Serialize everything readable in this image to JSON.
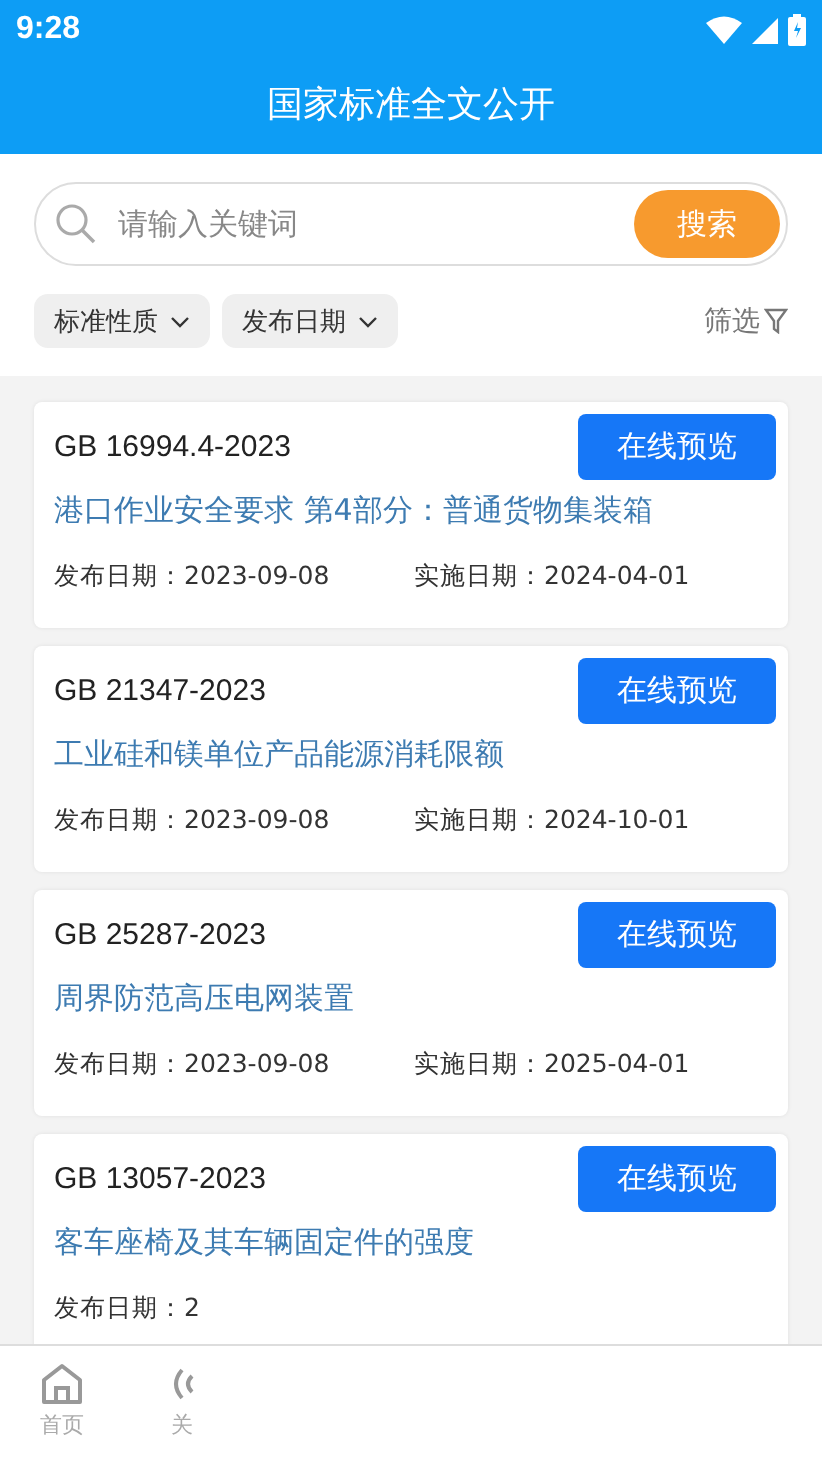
{
  "status_bar": {
    "time": "9:28"
  },
  "header": {
    "title": "国家标准全文公开"
  },
  "search": {
    "placeholder": "请输入关键词",
    "button": "搜索"
  },
  "filters": [
    {
      "label": "标准性质"
    },
    {
      "label": "发布日期"
    }
  ],
  "filter_button": "筛选",
  "standards": [
    {
      "code": "GB 16994.4-2023",
      "title": "港口作业安全要求 第4部分：普通货物集装箱",
      "published": "发布日期：2023-09-08",
      "effective": "实施日期：2024-04-01",
      "action": "在线预览"
    },
    {
      "code": "GB 21347-2023",
      "title": "工业硅和镁单位产品能源消耗限额",
      "published": "发布日期：2023-09-08",
      "effective": "实施日期：2024-10-01",
      "action": "在线预览"
    },
    {
      "code": "GB 25287-2023",
      "title": "周界防范高压电网装置",
      "published": "发布日期：2023-09-08",
      "effective": "实施日期：2025-04-01",
      "action": "在线预览"
    },
    {
      "code": "GB 13057-2023",
      "title": "客车座椅及其车辆固定件的强度",
      "published": "发布日期：2",
      "action": "在线预览"
    }
  ],
  "nav": [
    {
      "kind": "home",
      "label": "首页"
    },
    {
      "kind": "signal",
      "label": "关"
    }
  ]
}
